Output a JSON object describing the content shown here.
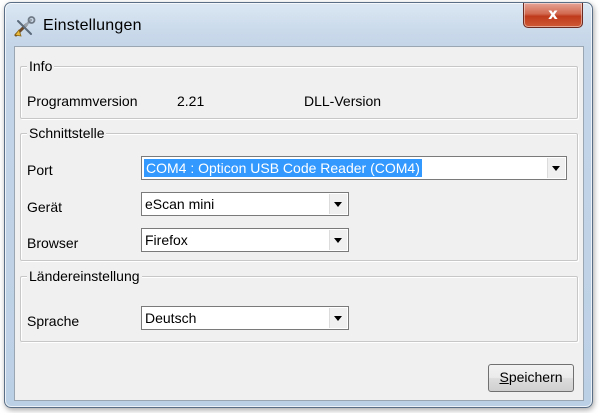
{
  "window": {
    "title": "Einstellungen",
    "close_label": "x",
    "app_icon": "wrench-screwdriver-icon"
  },
  "info": {
    "legend": "Info",
    "program_version_label": "Programmversion",
    "program_version_value": "2.21",
    "dll_version_label": "DLL-Version"
  },
  "interface": {
    "legend": "Schnittstelle",
    "port_label": "Port",
    "port_value": "COM4 :  Opticon USB Code Reader (COM4)",
    "device_label": "Gerät",
    "device_value": "eScan mini",
    "browser_label": "Browser",
    "browser_value": "Firefox"
  },
  "locale": {
    "legend": "Ländereinstellung",
    "language_label": "Sprache",
    "language_value": "Deutsch"
  },
  "actions": {
    "save_label_underlined": "S",
    "save_label_rest": "peichern"
  },
  "colors": {
    "selection": "#3399ff",
    "close_button": "#c9462a"
  }
}
